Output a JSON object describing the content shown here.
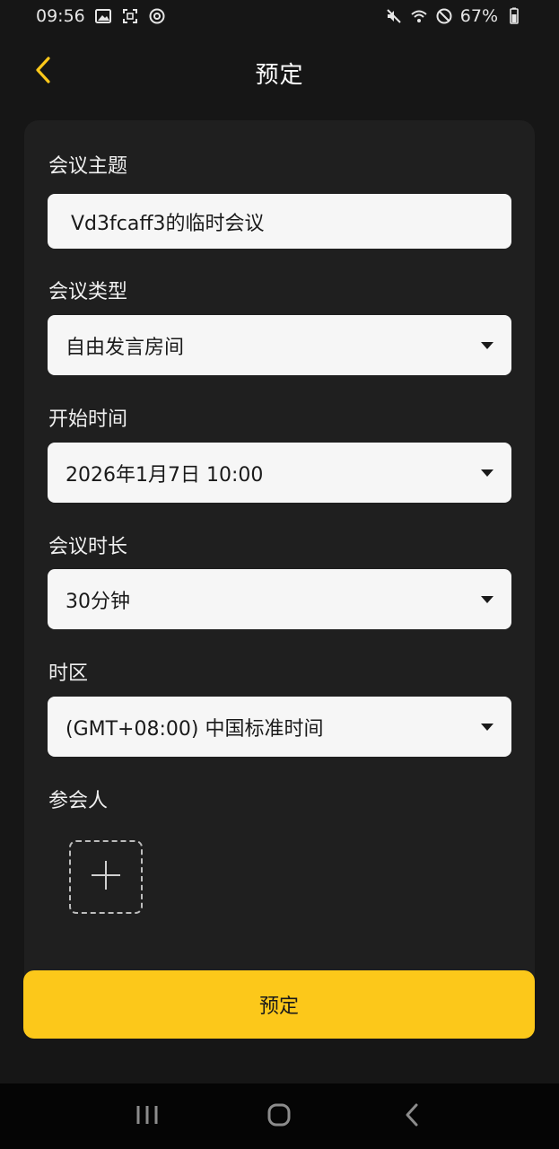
{
  "status_bar": {
    "time": "09:56",
    "battery": "67%",
    "icons_left": [
      "image-icon",
      "screenshot-icon",
      "sync-icon"
    ],
    "icons_right": [
      "mute-icon",
      "wifi-icon",
      "block-icon",
      "battery-icon"
    ]
  },
  "header": {
    "title": "预定",
    "back_icon": "chevron-left-icon",
    "accent_color": "#fcc81a"
  },
  "form": {
    "subject": {
      "label": "会议主题",
      "value": "Vd3fcaff3的临时会议"
    },
    "type": {
      "label": "会议类型",
      "value": "自由发言房间"
    },
    "start_time": {
      "label": "开始时间",
      "value": "2026年1月7日 10:00"
    },
    "duration": {
      "label": "会议时长",
      "value": "30分钟"
    },
    "timezone": {
      "label": "时区",
      "value": "(GMT+08:00) 中国标准时间"
    },
    "attendees": {
      "label": "参会人",
      "add_icon": "plus-icon"
    }
  },
  "submit": {
    "label": "预定",
    "color": "#fcc81a"
  },
  "nav_bar": {
    "recents_icon": "recents-icon",
    "home_icon": "home-icon",
    "back_icon": "back-icon"
  }
}
